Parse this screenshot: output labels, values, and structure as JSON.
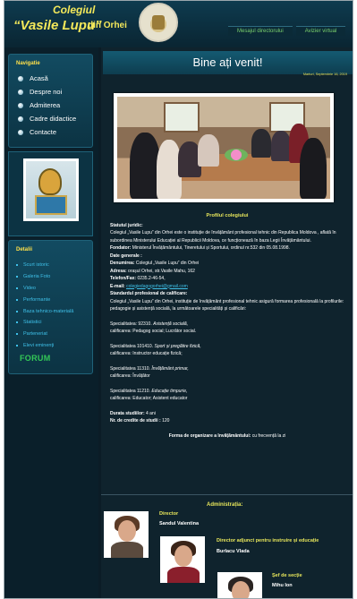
{
  "header": {
    "brand_line1": "Colegiul",
    "brand_line2": "“Vasile Lupu”",
    "brand_line3": "din Orhei",
    "logo_icon": "college-crest-icon",
    "top_links": [
      "Mesajul directorului",
      "Avizier virtual"
    ]
  },
  "sidebar": {
    "nav_title": "Navigatie",
    "nav_items": [
      "Acasă",
      "Despre noi",
      "Admiterea",
      "Cadre didactice",
      "Contacte"
    ],
    "details_title": "Detalii",
    "details_items": [
      "Scurt istoric",
      "Galeria Foto",
      "Video",
      "Performante",
      "Baza tehnico-materială",
      "Statistici",
      "Parteneriat",
      "Elevi eminenți"
    ],
    "forum_label": "FORUM"
  },
  "main": {
    "welcome": "Bine ați venit!",
    "date": "Marturi, Septembrie 16, 2019",
    "profile": {
      "title": "Profilul colegiului",
      "statut_label": "Statutul juridic:",
      "statut_text": "Colegiul „Vasile Lupu” din Orhei este o instituție de învățământ profesional tehnic din Republica Moldova , aflată în subordinea Ministerului Educației al Republicii Moldova, ce funcționează în baza Legii Învățământului.",
      "fondator_label": "Fondator:",
      "fondator_text": "Ministerul Învățământului, Tineretului și Sportului, ordinul nr.532 din 05.08.1998.",
      "date_generale": "Date generale :",
      "denumirea_label": "Denumirea:",
      "denumirea_text": "Colegiul „Vasile Lupu” din Orhei",
      "adresa_label": "Adresa:",
      "adresa_text": "orașul Orhei, str.Vasile Mahu, 162",
      "tel_label": "Telefon/Fax:",
      "tel_text": "0235.2-46-54,",
      "email_label": "E-mail:",
      "email_text": "colegiedagogorhei@gmail.com",
      "standard_label": "Standardul profesional de calificare:",
      "standard_text": "Colegiul „Vasile Lupu” din Orhei, instituție de învățământ profesional tehnic asigură formarea profesională la profilurile: pedagogie și asistență socială, la următoarele specialități și calificări:",
      "spec1_code": "Specialitatea: 92310.",
      "spec1_name": "Asistență socială,",
      "spec1_calif": "calificarea: Pedagog social; Lucrător social.",
      "spec2_code": "Specialitatea 101410.",
      "spec2_name": "Sport și pregătire fizică,",
      "spec2_calif": "calificarea: Instructor educație fizică;",
      "spec3_code": "Specialitatea 11310.",
      "spec3_name": "Învățământ primar,",
      "spec3_calif": "calificarea: Învățător",
      "spec4_code": "Specialitatea 11210.",
      "spec4_name": "Educație timpurie,",
      "spec4_calif": "calificarea: Educator; Asistent educator",
      "durata_label": "Durata studiilor:",
      "durata_text": "4 ani",
      "credite_label": "Nr. de credite de studii :",
      "credite_text": "120",
      "forma_label": "Forma de organizare a învățământului:",
      "forma_text": "cu frecvență la zi"
    },
    "admin": {
      "title": "Administrația:",
      "people": [
        {
          "role": "Director",
          "name": "Sandul Valentina"
        },
        {
          "role": "Director adjunct pentru instruire și educație",
          "name": "Burlacu Vlada"
        },
        {
          "role": "Șef de secție",
          "name": "Mihu Ion"
        }
      ]
    }
  }
}
